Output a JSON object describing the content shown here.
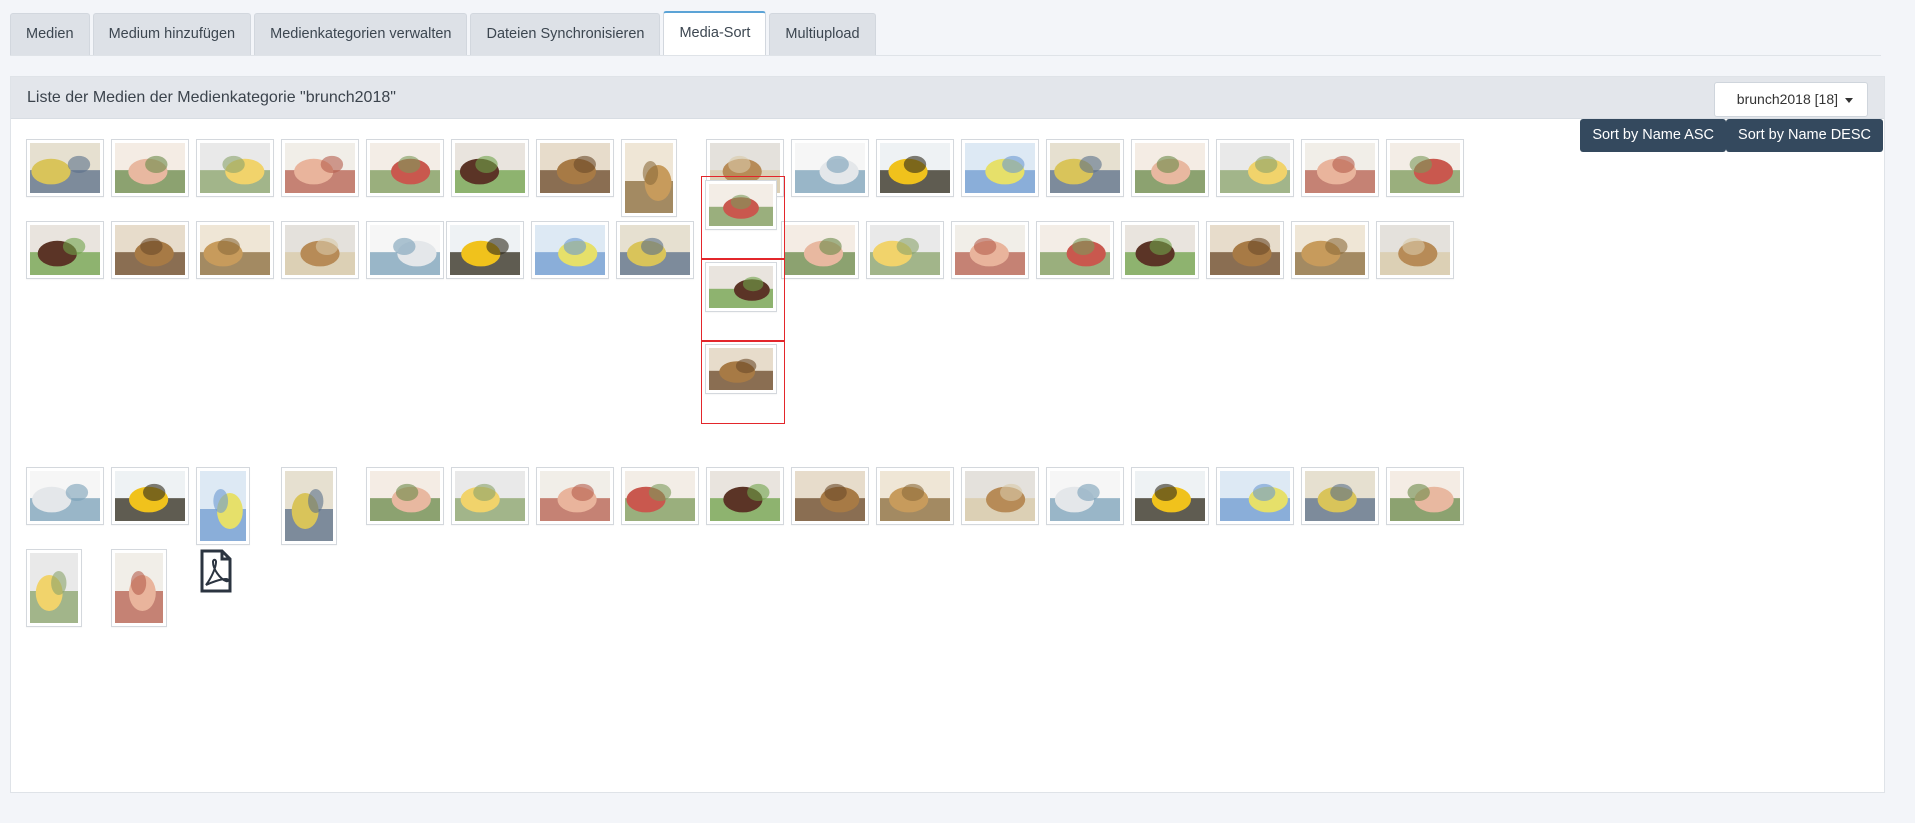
{
  "tabs": [
    {
      "label": "Medien",
      "active": false
    },
    {
      "label": "Medium hinzufügen",
      "active": false
    },
    {
      "label": "Medienkategorien verwalten",
      "active": false
    },
    {
      "label": "Dateien Synchronisieren",
      "active": false
    },
    {
      "label": "Media-Sort",
      "active": true
    },
    {
      "label": "Multiupload",
      "active": false
    }
  ],
  "panel": {
    "title": "Liste der Medien der Medienkategorie \"brunch2018\"",
    "category_select": "brunch2018 [18]"
  },
  "sort": {
    "asc_label": "Sort by Name ASC",
    "desc_label": "Sort by Name DESC"
  },
  "colors": {
    "accent": "#34495e",
    "tab_active_border": "#5ba3d6",
    "drag_highlight": "#e3262b"
  },
  "media_rows": [
    {
      "thumbs": [
        {
          "name": "group-yellow-shirts"
        },
        {
          "name": "ham-platter"
        },
        {
          "name": "sunflower-table"
        },
        {
          "name": "ham-platter-2"
        },
        {
          "name": "meat-platter"
        },
        {
          "name": "chocolate-cake"
        },
        {
          "name": "bread-loaf"
        },
        {
          "name": "bread-basket"
        },
        {
          "name": "sheet-cake"
        },
        {
          "name": "table-setting"
        },
        {
          "name": "sunflower"
        },
        {
          "name": "yellow-drink"
        },
        {
          "name": "glasses"
        },
        {
          "name": "jam-jars"
        },
        {
          "name": "wine-bottles"
        },
        {
          "name": "shelf-jars"
        },
        {
          "name": "sunflowers-vase"
        }
      ]
    },
    {
      "thumbs": [
        {
          "name": "courtyard"
        },
        {
          "name": "jam-table"
        },
        {
          "name": "buffet-table"
        },
        {
          "name": "cheese-platter"
        },
        {
          "name": "salmon-platter"
        },
        {
          "name": "white-platter"
        },
        {
          "name": "cheese-board"
        },
        {
          "name": "buffet-guests"
        },
        {
          "name": "garden-tables"
        },
        {
          "name": "umbrella-guests"
        },
        {
          "name": "tree-guests"
        },
        {
          "name": "seated-guests"
        },
        {
          "name": "speaker-yellow"
        },
        {
          "name": "honey-jar"
        },
        {
          "name": "speaker-crowd"
        },
        {
          "name": "tree-crowd"
        }
      ]
    },
    {
      "thumbs": [
        {
          "name": "guests-umbrella"
        },
        {
          "name": "guests-tables"
        },
        {
          "name": "family-portrait"
        },
        {
          "name": "dog"
        },
        {
          "name": "garden-tent"
        },
        {
          "name": "garden-tent-2"
        },
        {
          "name": "trampoline"
        },
        {
          "name": "trampoline-2"
        },
        {
          "name": "flower-detail"
        },
        {
          "name": "kids-playground"
        },
        {
          "name": "market-stall"
        },
        {
          "name": "name-card"
        },
        {
          "name": "blueberry-cake"
        },
        {
          "name": "stall-people"
        },
        {
          "name": "couple-yellow"
        },
        {
          "name": "fruit-basket"
        },
        {
          "name": "watermelon"
        }
      ]
    },
    {
      "thumbs": [
        {
          "name": "dessert-glass"
        },
        {
          "name": "dessert-glass-2"
        },
        {
          "name": "pdf-file"
        }
      ]
    }
  ],
  "dragged": [
    {
      "name": "cherry-pie"
    },
    {
      "name": "apple-strudel"
    },
    {
      "name": "apple-strudel-2"
    }
  ]
}
